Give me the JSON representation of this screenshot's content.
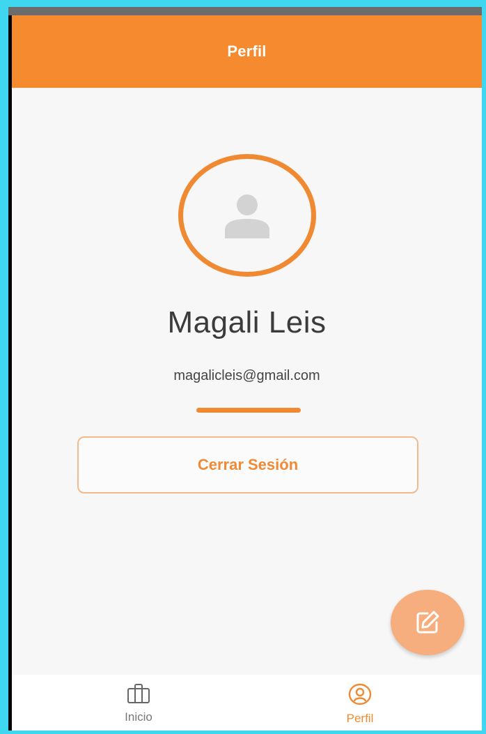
{
  "appbar": {
    "title": "Perfil"
  },
  "profile": {
    "name": "Magali Leis",
    "email": "magalicleis@gmail.com",
    "avatar_icon": "person-placeholder-icon"
  },
  "actions": {
    "logout_label": "Cerrar Sesión",
    "fab_icon": "edit-icon"
  },
  "bottom_nav": {
    "items": [
      {
        "label": "Inicio",
        "icon": "briefcase-icon",
        "active": false
      },
      {
        "label": "Perfil",
        "icon": "user-circle-icon",
        "active": true
      }
    ]
  },
  "colors": {
    "accent": "#f58a2e",
    "fab": "#f7ae7e",
    "inactive_nav": "#777777"
  }
}
